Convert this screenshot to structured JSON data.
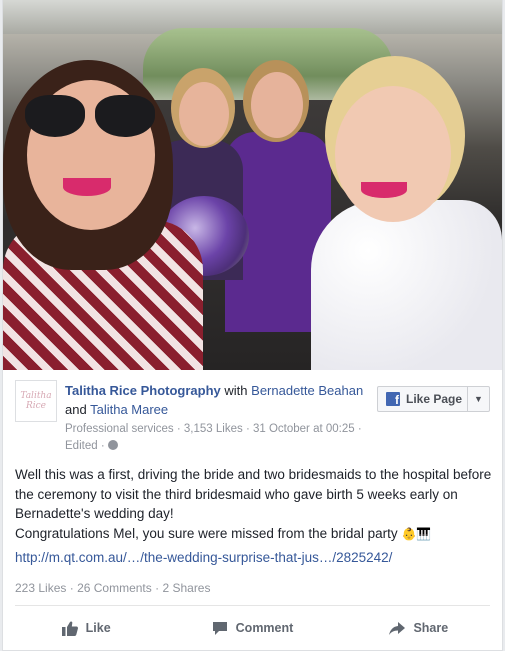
{
  "photo": {
    "alt": ""
  },
  "header": {
    "page_name": "Talitha Rice Photography",
    "with_text": "with",
    "tagged_1": "Bernadette Beahan",
    "and_text": "and",
    "tagged_2": "Talitha Maree",
    "category": "Professional services",
    "likes": "3,153 Likes",
    "date": "31 October at 00:25",
    "edited": "Edited",
    "logo_text": "Talitha Rice"
  },
  "like_page": {
    "label": "Like Page",
    "icon": "f"
  },
  "post": {
    "line1": "Well this was a first, driving the bride and two bridesmaids to the hospital before the ceremony to visit the third bridesmaid who gave birth 5 weeks early on Bernadette's wedding day!",
    "line2": "Congratulations Mel, you sure were missed from the bridal party",
    "emoji_1": "👶",
    "emoji_2": "🎹",
    "link": "http://m.qt.com.au/…/the-wedding-surprise-that-jus…/2825242/"
  },
  "stats": {
    "likes": "223 Likes",
    "comments": "26 Comments",
    "shares": "2 Shares",
    "sep": "·"
  },
  "actions": {
    "like": "Like",
    "comment": "Comment",
    "share": "Share"
  },
  "colors": {
    "link": "#365899",
    "muted": "#90949c",
    "brand": "#4267b2"
  }
}
